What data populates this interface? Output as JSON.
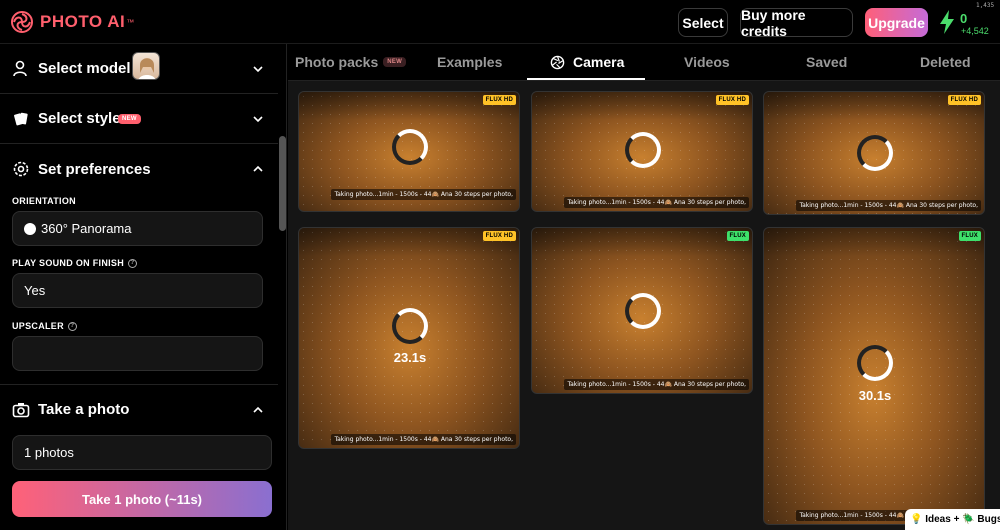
{
  "header": {
    "logo_text": "PHOTO AI",
    "logo_tm": "™",
    "select_label": "Select",
    "buy_credits_label": "Buy more credits",
    "upgrade_label": "Upgrade",
    "credits": "0",
    "credits_added": "+4,542",
    "counter": "1,435"
  },
  "sidebar": {
    "select_model": "Select model",
    "select_style": "Select style",
    "new_badge": "NEW",
    "set_preferences": "Set preferences",
    "orientation_label": "ORIENTATION",
    "orientation_value": "360° Panorama",
    "play_sound_label": "PLAY SOUND ON FINISH",
    "play_sound_value": "Yes",
    "upscaler_label": "UPSCALER",
    "upscaler_value": "",
    "take_photo": "Take a photo",
    "photos_count": "1 photos",
    "take_button": "Take 1 photo (~11s)"
  },
  "tabs": {
    "photo_packs": "Photo packs",
    "photo_packs_badge": "NEW",
    "examples": "Examples",
    "camera": "Camera",
    "videos": "Videos",
    "saved": "Saved",
    "deleted": "Deleted"
  },
  "cards": [
    {
      "badge": "FLUX HD",
      "caption": "Taking photo...1min - 1500s - 44🙈 Ana 30 steps per photo,",
      "timer": ""
    },
    {
      "badge": "FLUX HD",
      "caption": "Taking photo...1min - 1500s - 44🙈 Ana 30 steps per photo,",
      "timer": ""
    },
    {
      "badge": "FLUX HD",
      "caption": "Taking photo...1min - 1500s - 44🙈 Ana 30 steps per photo,",
      "timer": ""
    },
    {
      "badge": "FLUX HD",
      "caption": "Taking photo...1min - 1500s - 44🙈 Ana 30 steps per photo,",
      "timer": "23.1s"
    },
    {
      "badge": "FLUX",
      "caption": "Taking photo...1min - 1500s - 44🙈 Ana 30 steps per photo,",
      "timer": ""
    },
    {
      "badge": "FLUX",
      "caption": "Taking photo...1min - 1500s - 44🙈 Ana 30 steps per photo,",
      "timer": "30.1s"
    }
  ],
  "feedback": "💡 Ideas + 🪲 Bugs",
  "colors": {
    "accent": "#ff5f6d",
    "credits_green": "#4bdc6c",
    "flux_hd": "#ffc227",
    "flux": "#3ee06a"
  }
}
